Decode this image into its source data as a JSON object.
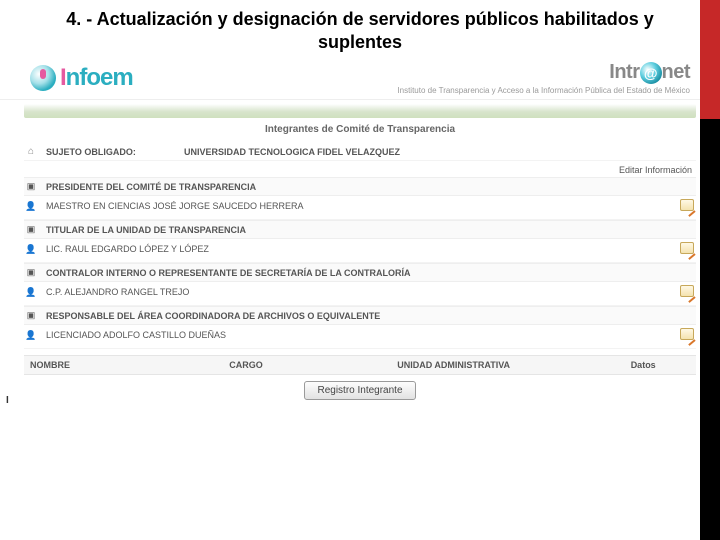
{
  "slide": {
    "title": "4. - Actualización y designación de servidores públicos habilitados y suplentes"
  },
  "header": {
    "logo_prefix": "I",
    "logo_rest": "nfoem",
    "intranet_pre": "Intr",
    "intranet_post": "net",
    "institute_line": "Instituto de Transparencia y Acceso a la Información Pública del Estado de México"
  },
  "page_heading": "Integrantes de Comité de Transparencia",
  "subject": {
    "label": "SUJETO OBLIGADO:",
    "value": "UNIVERSIDAD TECNOLOGICA FIDEL VELAZQUEZ"
  },
  "edit_info_link": "Editar Información",
  "sections": [
    {
      "role": "PRESIDENTE DEL COMITÉ DE TRANSPARENCIA",
      "member": "MAESTRO EN CIENCIAS JOSÉ JORGE SAUCEDO HERRERA"
    },
    {
      "role": "TITULAR DE LA UNIDAD DE TRANSPARENCIA",
      "member": "LIC. RAUL EDGARDO LÓPEZ Y LÓPEZ"
    },
    {
      "role": "CONTRALOR INTERNO O REPRESENTANTE DE SECRETARÍA DE LA CONTRALORÍA",
      "member": "C.P. ALEJANDRO RANGEL TREJO"
    },
    {
      "role": "RESPONSABLE DEL ÁREA COORDINADORA DE ARCHIVOS O EQUIVALENTE",
      "member": "LICENCIADO ADOLFO CASTILLO DUEÑAS"
    }
  ],
  "table": {
    "columns": {
      "nombre": "NOMBRE",
      "cargo": "CARGO",
      "unidad": "UNIDAD ADMINISTRATIVA",
      "datos": "Datos"
    }
  },
  "button_label": "Registro Integrante",
  "gutter_mark": "I"
}
